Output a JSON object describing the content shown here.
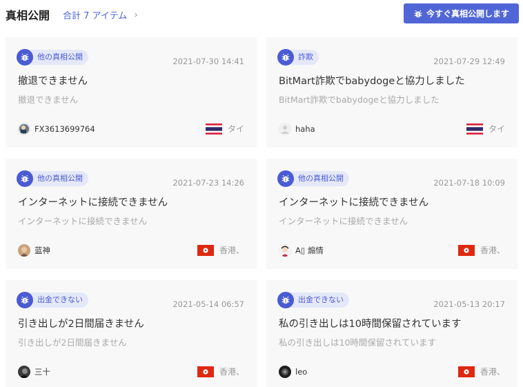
{
  "header": {
    "title": "真相公開",
    "total_label": "合計 7 アイテム",
    "cta_label": "今すぐ真相公開します"
  },
  "colors": {
    "accent": "#5166d6",
    "tag_bg": "#e4e8f8",
    "card_bg": "#f8f8f9"
  },
  "cards": [
    {
      "tag": "他の真相公開",
      "date": "2021-07-30 14:41",
      "headline": "撤退できません",
      "summary": "撤退できません",
      "author": "FX3613699764",
      "country": "タイ",
      "flag": "thailand-flag-icon"
    },
    {
      "tag": "詐欺",
      "date": "2021-07-29 12:49",
      "headline": "BitMart詐欺でbabydogeと協力しました",
      "summary": "BitMart詐欺でbabydogeと協力しました",
      "author": "haha",
      "country": "タイ",
      "flag": "thailand-flag-icon"
    },
    {
      "tag": "他の真相公開",
      "date": "2021-07-23 14:26",
      "headline": "インターネットに接続できません",
      "summary": "インターネットに接続できません",
      "author": "蓝神",
      "country": "香港、",
      "flag": "hongkong-flag-icon"
    },
    {
      "tag": "他の真相公開",
      "date": "2021-07-18 10:09",
      "headline": "インターネットに接続できません",
      "summary": "インターネットに接続できません",
      "author": "A▯ 煽情",
      "country": "香港、",
      "flag": "hongkong-flag-icon"
    },
    {
      "tag": "出金できない",
      "date": "2021-05-14 06:57",
      "headline": "引き出しが2日間届きません",
      "summary": "引き出しが2日間届きません",
      "author": "三十",
      "country": "香港、",
      "flag": "hongkong-flag-icon"
    },
    {
      "tag": "出金できない",
      "date": "2021-05-13 20:17",
      "headline": "私の引き出しは10時間保留されています",
      "summary": "私の引き出しは10時間保留されています",
      "author": "leo",
      "country": "香港、",
      "flag": "hongkong-flag-icon"
    }
  ]
}
